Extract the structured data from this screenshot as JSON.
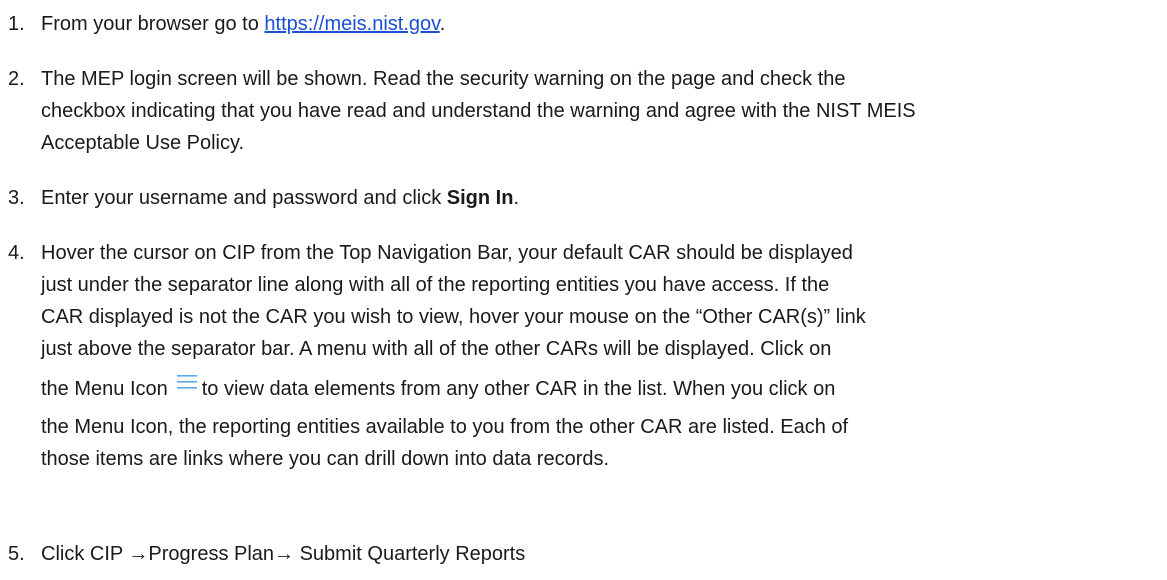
{
  "steps": [
    {
      "number": "1.",
      "text_before": "From your browser go to ",
      "link": "https://meis.nist.gov",
      "text_after": "."
    },
    {
      "number": "2.",
      "lines": [
        "The MEP login screen will be shown. Read the security warning on the page and check the",
        "checkbox indicating that you have read and understand the warning and agree with the NIST MEIS",
        "Acceptable Use Policy."
      ]
    },
    {
      "number": "3.",
      "text_before": "Enter your username and password and click ",
      "bold": "Sign In",
      "text_after": "."
    },
    {
      "number": "4.",
      "lines": [
        "Hover the cursor on CIP from the Top Navigation Bar, your default CAR should be displayed",
        "just under the separator line along with all of the reporting entities you have access. If the",
        "CAR displayed is not the CAR you wish to view, hover your mouse on the “Other CAR(s)” link",
        "just above the separator bar.  A menu with all of the other CARs will be displayed.  Click on"
      ],
      "icon_line_before": "the Menu Icon",
      "icon_name": "menu-icon",
      "icon_line_after": "to view data elements from any other CAR in the list.  When you click on",
      "lines_after": [
        "the Menu Icon, the reporting entities available to you from the other CAR are listed.  Each of",
        "those items are links where you can drill down into data records."
      ]
    },
    {
      "number": "5.",
      "text": "Click CIP →Progress Plan→ Submit Quarterly Reports"
    }
  ],
  "colors": {
    "text": "#1a1a1a",
    "link": "#1a4fd6",
    "menu_icon": "#5aa9f0"
  }
}
